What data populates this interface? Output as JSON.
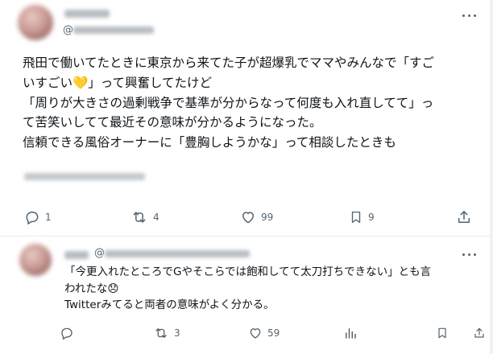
{
  "post": {
    "handle_prefix": "@",
    "text": "飛田で働いてたときに東京から来てた子が超爆乳でママやみんなで「すご\nいすごい💛」って興奮してたけど\n「周りが大きさの過剰戦争で基準が分からなって何度も入れ直してて」っ\nて苦笑いしてて最近その意味が分かるようになった。\n信頼できる風俗オーナーに「豊胸しようかな」って相談したときも",
    "actions": {
      "replies": "1",
      "reposts": "4",
      "likes": "99",
      "bookmarks": "9"
    }
  },
  "reply": {
    "handle_prefix": "@",
    "text": "「今更入れたところでGやそこらでは飽和してて太刀打ちできない」とも言\nわれたな😞\nTwitterみてると両者の意味がよく分かる。",
    "actions": {
      "replies": "",
      "reposts": "3",
      "likes": "59",
      "views": ""
    }
  },
  "colors": {
    "text": "#0f1419",
    "secondary": "#536471",
    "divider": "#e7eaed",
    "background": "#ffffff"
  }
}
